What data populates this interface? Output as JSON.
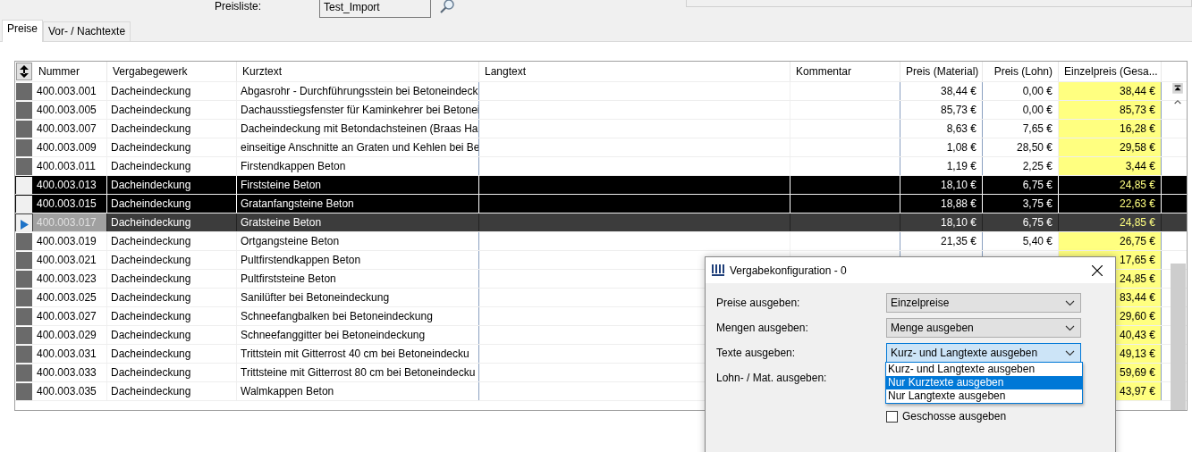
{
  "header": {
    "price_list_label": "Preisliste:",
    "price_list_value": "Test_Import"
  },
  "tabs": [
    {
      "label": "Preise",
      "selected": true
    },
    {
      "label": "Vor- / Nachtexte",
      "selected": false
    }
  ],
  "table": {
    "columns": [
      "Nummer",
      "Vergabegewerk",
      "Kurztext",
      "Langtext",
      "Kommentar",
      "Preis (Material)",
      "Preis (Lohn)",
      "Einzelpreis (Gesa..."
    ],
    "rows": [
      {
        "nummer": "400.003.001",
        "gewerk": "Dacheindeckung",
        "kurztext": "Abgasrohr - Durchführungsstein bei Betoneindeck",
        "material": "38,44 €",
        "lohn": "0,00 €",
        "einzelpreis": "38,44 €",
        "selected": false,
        "current": false
      },
      {
        "nummer": "400.003.005",
        "gewerk": "Dacheindeckung",
        "kurztext": "Dachausstiegsfenster für Kaminkehrer bei Betonei",
        "material": "85,73 €",
        "lohn": "0,00 €",
        "einzelpreis": "85,73 €",
        "selected": false,
        "current": false
      },
      {
        "nummer": "400.003.007",
        "gewerk": "Dacheindeckung",
        "kurztext": "Dacheindeckung mit Betondachsteinen (Braas Ha",
        "material": "8,63 €",
        "lohn": "7,65 €",
        "einzelpreis": "16,28 €",
        "selected": false,
        "current": false
      },
      {
        "nummer": "400.003.009",
        "gewerk": "Dacheindeckung",
        "kurztext": "einseitige Anschnitte an Graten und Kehlen bei Be",
        "material": "1,08 €",
        "lohn": "28,50 €",
        "einzelpreis": "29,58 €",
        "selected": false,
        "current": false
      },
      {
        "nummer": "400.003.011",
        "gewerk": "Dacheindeckung",
        "kurztext": "Firstendkappen Beton",
        "material": "1,19 €",
        "lohn": "2,25 €",
        "einzelpreis": "3,44 €",
        "selected": false,
        "current": false
      },
      {
        "nummer": "400.003.013",
        "gewerk": "Dacheindeckung",
        "kurztext": "Firststeine Beton",
        "material": "18,10 €",
        "lohn": "6,75 €",
        "einzelpreis": "24,85 €",
        "selected": true,
        "current": false
      },
      {
        "nummer": "400.003.015",
        "gewerk": "Dacheindeckung",
        "kurztext": "Gratanfangsteine Beton",
        "material": "18,88 €",
        "lohn": "3,75 €",
        "einzelpreis": "22,63 €",
        "selected": true,
        "current": false
      },
      {
        "nummer": "400.003.017",
        "gewerk": "Dacheindeckung",
        "kurztext": "Gratsteine Beton",
        "material": "18,10 €",
        "lohn": "6,75 €",
        "einzelpreis": "24,85 €",
        "selected": false,
        "current": true
      },
      {
        "nummer": "400.003.019",
        "gewerk": "Dacheindeckung",
        "kurztext": "Ortgangsteine Beton",
        "material": "21,35 €",
        "lohn": "5,40 €",
        "einzelpreis": "26,75 €",
        "selected": false,
        "current": false
      },
      {
        "nummer": "400.003.021",
        "gewerk": "Dacheindeckung",
        "kurztext": "Pultfirstendkappen Beton",
        "einzelpreis": "17,65 €",
        "selected": false,
        "current": false
      },
      {
        "nummer": "400.003.023",
        "gewerk": "Dacheindeckung",
        "kurztext": "Pultfirststeine Beton",
        "einzelpreis": "24,85 €",
        "selected": false,
        "current": false
      },
      {
        "nummer": "400.003.025",
        "gewerk": "Dacheindeckung",
        "kurztext": "Sanilüfter bei Betoneindeckung",
        "einzelpreis": "83,44 €",
        "selected": false,
        "current": false
      },
      {
        "nummer": "400.003.027",
        "gewerk": "Dacheindeckung",
        "kurztext": "Schneefangbalken bei Betoneindeckung",
        "einzelpreis": "29,60 €",
        "selected": false,
        "current": false
      },
      {
        "nummer": "400.003.029",
        "gewerk": "Dacheindeckung",
        "kurztext": "Schneefanggitter bei Betoneindeckung",
        "einzelpreis": "40,43 €",
        "selected": false,
        "current": false
      },
      {
        "nummer": "400.003.031",
        "gewerk": "Dacheindeckung",
        "kurztext": "Trittstein mit Gitterrost 40 cm bei Betoneindecku",
        "einzelpreis": "49,13 €",
        "selected": false,
        "current": false
      },
      {
        "nummer": "400.003.033",
        "gewerk": "Dacheindeckung",
        "kurztext": "Trittsteine mit Gitterrost 80 cm bei Betoneindecku",
        "einzelpreis": "59,69 €",
        "selected": false,
        "current": false
      },
      {
        "nummer": "400.003.035",
        "gewerk": "Dacheindeckung",
        "kurztext": "Walmkappen Beton",
        "einzelpreis": "43,97 €",
        "selected": false,
        "current": false
      }
    ]
  },
  "dialog": {
    "title": "Vergabekonfiguration - 0",
    "fields": [
      {
        "kind": "combo",
        "label": "Preise ausgeben:",
        "value": "Einzelpreise",
        "focused": false
      },
      {
        "kind": "combo",
        "label": "Mengen ausgeben:",
        "value": "Menge ausgeben",
        "focused": false
      },
      {
        "kind": "combo",
        "label": "Texte ausgeben:",
        "value": "Kurz- und Langtexte ausgeben",
        "focused": true
      },
      {
        "kind": "label",
        "label": "Lohn- / Mat. ausgeben:"
      },
      {
        "kind": "checkbox",
        "label": "Geschosse ausgeben",
        "checked": false
      }
    ],
    "dropdown": [
      {
        "label": "Kurz- und Langtexte ausgeben",
        "selected": false
      },
      {
        "label": "Nur Kurztexte ausgeben",
        "selected": true
      },
      {
        "label": "Nur Langtexte ausgeben",
        "selected": false
      }
    ]
  }
}
